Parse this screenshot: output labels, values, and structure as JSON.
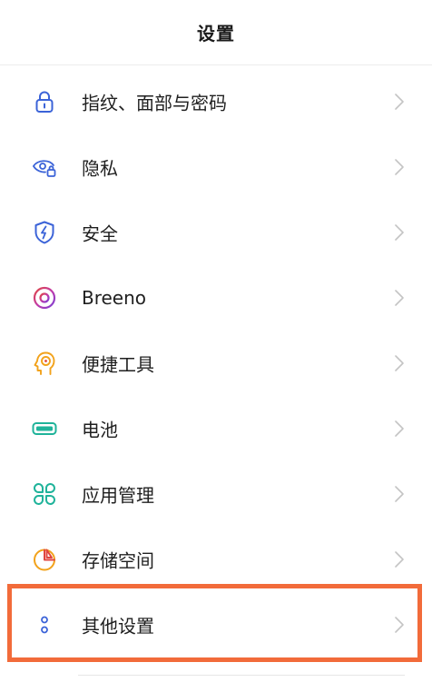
{
  "header": {
    "title": "设置"
  },
  "colors": {
    "highlight_border": "#f26b3a",
    "chevron": "#c4c4c4"
  },
  "items": [
    {
      "label": "指纹、面部与密码",
      "icon": "lock-icon",
      "icon_color": "#3b63d8"
    },
    {
      "label": "隐私",
      "icon": "eye-lock-icon",
      "icon_color": "#3b63d8"
    },
    {
      "label": "安全",
      "icon": "shield-bolt-icon",
      "icon_color": "#3b63d8"
    },
    {
      "label": "Breeno",
      "icon": "breeno-ring-icon",
      "icon_color": "#c23aa8"
    },
    {
      "label": "便捷工具",
      "icon": "head-target-icon",
      "icon_color": "#f2a21b"
    },
    {
      "label": "电池",
      "icon": "battery-icon",
      "icon_color": "#1fb39a"
    },
    {
      "label": "应用管理",
      "icon": "app-grid-icon",
      "icon_color": "#1fb39a"
    },
    {
      "label": "存储空间",
      "icon": "storage-pie-icon",
      "icon_color": "#f2a21b"
    },
    {
      "label": "其他设置",
      "icon": "more-dots-icon",
      "icon_color": "#3b63d8"
    }
  ]
}
